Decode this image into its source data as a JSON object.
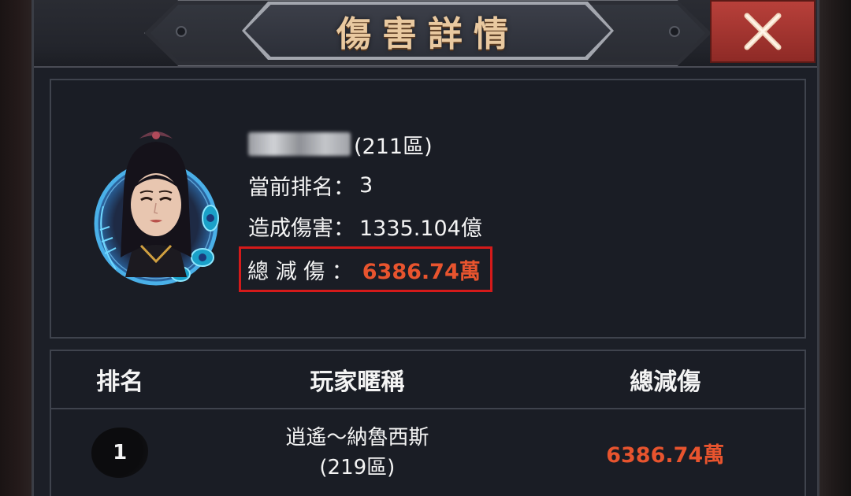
{
  "dialog": {
    "title": "傷害詳情",
    "close_icon": "close-x-icon",
    "accent_color": "#e8542e",
    "close_color": "#a83632"
  },
  "player": {
    "name_blurred": "",
    "server": "(211區)",
    "rank_label": "當前排名：",
    "rank_value": "3",
    "damage_label": "造成傷害：",
    "damage_value": "1335.104億",
    "reduction_label": "總 減 傷 ：",
    "reduction_value": "6386.74萬",
    "avatar_icon": "character-portrait-icon"
  },
  "table": {
    "headers": [
      "排名",
      "玩家暱稱",
      "總減傷"
    ],
    "rows": [
      {
        "rank": "1",
        "name": "逍遙〜納魯西斯",
        "server": "(219區)",
        "value": "6386.74萬"
      }
    ]
  }
}
